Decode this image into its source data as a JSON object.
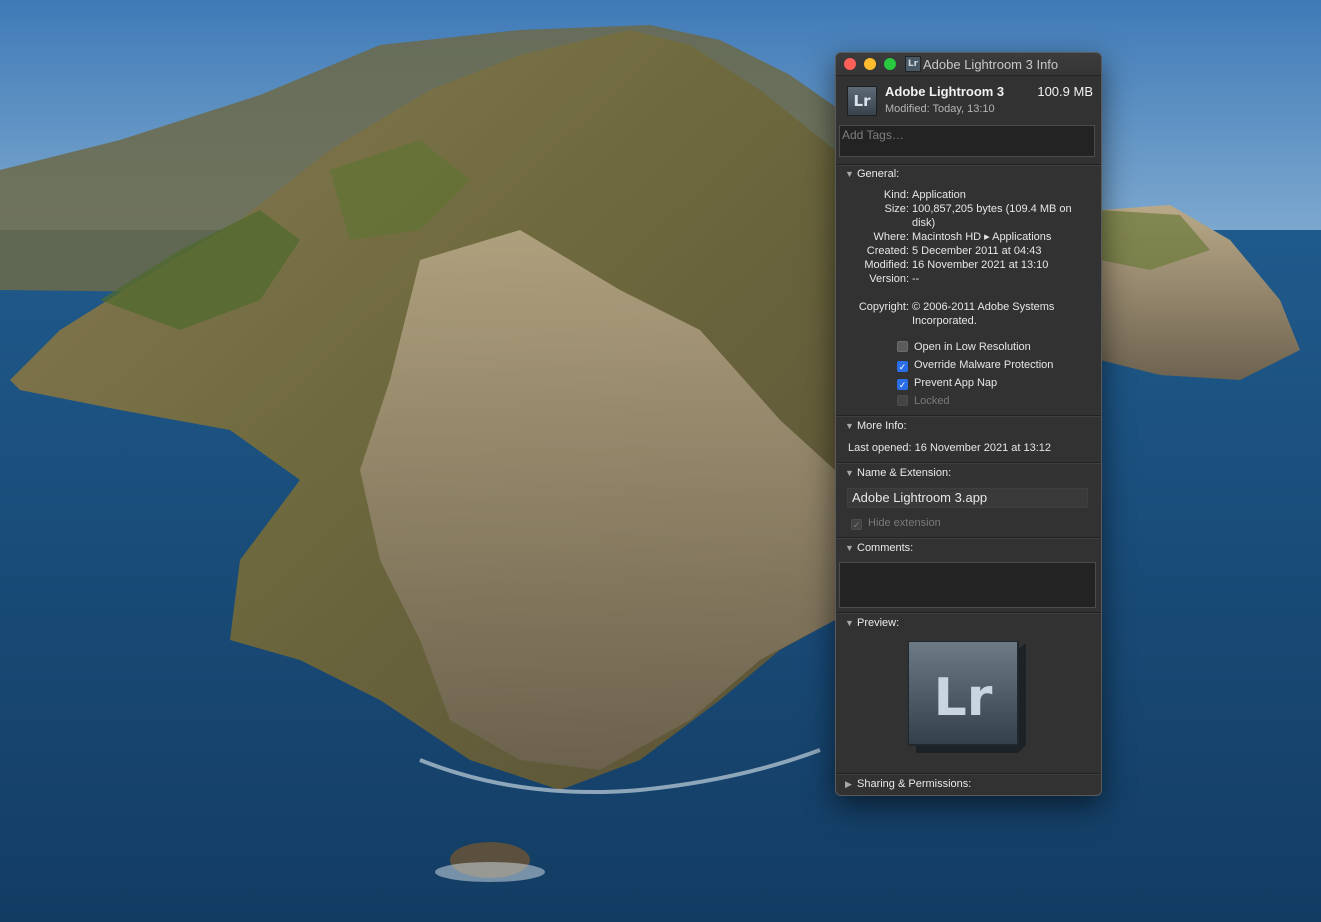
{
  "window": {
    "title": "Adobe Lightroom 3 Info",
    "icon_letters": "Lr"
  },
  "header": {
    "app_name": "Adobe Lightroom 3",
    "size": "100.9 MB",
    "modified": "Modified: Today, 13:10"
  },
  "tags": {
    "placeholder": "Add Tags…"
  },
  "general": {
    "heading": "General:",
    "kind_label": "Kind:",
    "kind_value": "Application",
    "size_label": "Size:",
    "size_value": "100,857,205 bytes (109.4 MB on disk)",
    "where_label": "Where:",
    "where_value": "Macintosh HD ▸ Applications",
    "created_label": "Created:",
    "created_value": "5 December 2011 at 04:43",
    "modified_label": "Modified:",
    "modified_value": "16 November 2021 at 13:10",
    "version_label": "Version:",
    "version_value": "--",
    "copyright_label": "Copyright:",
    "copyright_value": "© 2006-2011 Adobe Systems Incorporated.",
    "checkboxes": [
      {
        "label": "Open in Low Resolution",
        "checked": false,
        "enabled": true
      },
      {
        "label": "Override Malware Protection",
        "checked": true,
        "enabled": true
      },
      {
        "label": "Prevent App Nap",
        "checked": true,
        "enabled": true
      },
      {
        "label": "Locked",
        "checked": false,
        "enabled": false
      }
    ]
  },
  "more_info": {
    "heading": "More Info:",
    "last_opened": "Last opened: 16 November 2021 at 13:12"
  },
  "name_extension": {
    "heading": "Name & Extension:",
    "filename": "Adobe Lightroom 3.app",
    "hide_extension_label": "Hide extension",
    "hide_extension_checked": true
  },
  "comments": {
    "heading": "Comments:"
  },
  "preview": {
    "heading": "Preview:",
    "icon_letters": "Lr"
  },
  "sharing": {
    "heading": "Sharing & Permissions:"
  },
  "colors": {
    "accent": "#2a6ee7",
    "window_bg": "#323232",
    "close": "#fe5f57",
    "minimize": "#febc2e",
    "zoom": "#28c840"
  }
}
